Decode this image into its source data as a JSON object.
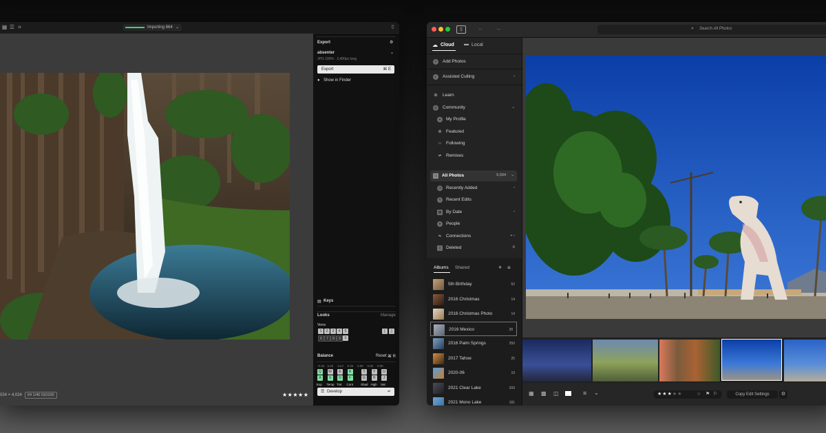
{
  "left_window": {
    "toolbar": {
      "import_status": "Importing 864",
      "import_chevron": "⌄"
    },
    "image_info": {
      "dimensions": "024 × 4,024",
      "lens": "f/4 1/40 ISO100"
    },
    "rating_stars": "★★★★★",
    "panel": {
      "export_title": "Export",
      "preset_name": "absenter",
      "preset_desc": "JPG 100% · 2,400px long",
      "export_button": "Export",
      "export_shortcut": "⌘ E",
      "show_in_finder": "Show in Finder",
      "keys_label": "Keys",
      "looks_label": "Looks",
      "manage_label": "Manage",
      "looks_group": "Verra",
      "looks_keys_row1": [
        "1",
        "2",
        "3",
        "4",
        "5"
      ],
      "looks_keys_row2": [
        "6",
        "7",
        "8",
        "9",
        "0"
      ],
      "looks_side_keys": [
        "[",
        "]"
      ],
      "balance_label": "Balance",
      "reset_label": "Reset",
      "reset_shortcut": "⌘ R",
      "balance_values": [
        "-0.33",
        "5.2k",
        "14.0",
        "0.32",
        "0.00",
        "0.00",
        "0.00"
      ],
      "balance_keys_row1": [
        "Q",
        "W",
        "E",
        "R",
        "T",
        "Y",
        "U"
      ],
      "balance_keys_row2": [
        "A",
        "S",
        "D",
        "F",
        "G",
        "H",
        "J"
      ],
      "balance_names": [
        "Exp",
        "Temp",
        "Tint",
        "Cont",
        "Shad",
        "High",
        "Sat"
      ],
      "develop_button": "Develop",
      "develop_shortcut": "↵"
    }
  },
  "right_window": {
    "search_placeholder": "Search All Photos",
    "sidebar": {
      "tabs": [
        {
          "label": "Cloud",
          "active": true
        },
        {
          "label": "Local",
          "active": false
        }
      ],
      "add_photos": "Add Photos",
      "assisted_culling": "Assisted Culling",
      "learn": "Learn",
      "community": "Community",
      "community_items": [
        "My Profile",
        "Featured",
        "Following",
        "Remixes"
      ],
      "all_photos": "All Photos",
      "all_photos_count": "5,594",
      "all_photos_items": [
        {
          "label": "Recently Added",
          "meta": "‹"
        },
        {
          "label": "Recent Edits",
          "meta": ""
        },
        {
          "label": "By Date",
          "meta": "‹"
        },
        {
          "label": "People",
          "meta": ""
        },
        {
          "label": "Connections",
          "meta": "+  ‹"
        },
        {
          "label": "Deleted",
          "meta": "6"
        }
      ],
      "album_tabs": [
        {
          "label": "Albums",
          "active": true
        },
        {
          "label": "Shared",
          "active": false
        }
      ],
      "albums": [
        {
          "name": "5th Birthday",
          "count": "52"
        },
        {
          "name": "2016 Christmas",
          "count": "14"
        },
        {
          "name": "2016 Christmas Photo",
          "count": "14"
        },
        {
          "name": "2016 Mexico",
          "count": "28"
        },
        {
          "name": "2016 Palm Springs",
          "count": "250"
        },
        {
          "name": "2017 Tahoe",
          "count": "25"
        },
        {
          "name": "2020-06",
          "count": "19"
        },
        {
          "name": "2021 Clear Lake",
          "count": "209"
        },
        {
          "name": "2021 Mono Lake",
          "count": "181"
        }
      ]
    },
    "bottombar": {
      "stars": "★★★★★",
      "rating": 3,
      "copy_edit_settings": "Copy Edit Settings"
    }
  },
  "colors": {
    "accent_green": "#3fd07a",
    "key_green": "#7fe0a2",
    "traffic_red": "#ff5f57",
    "traffic_yellow": "#febc2e",
    "traffic_green": "#28c840"
  }
}
